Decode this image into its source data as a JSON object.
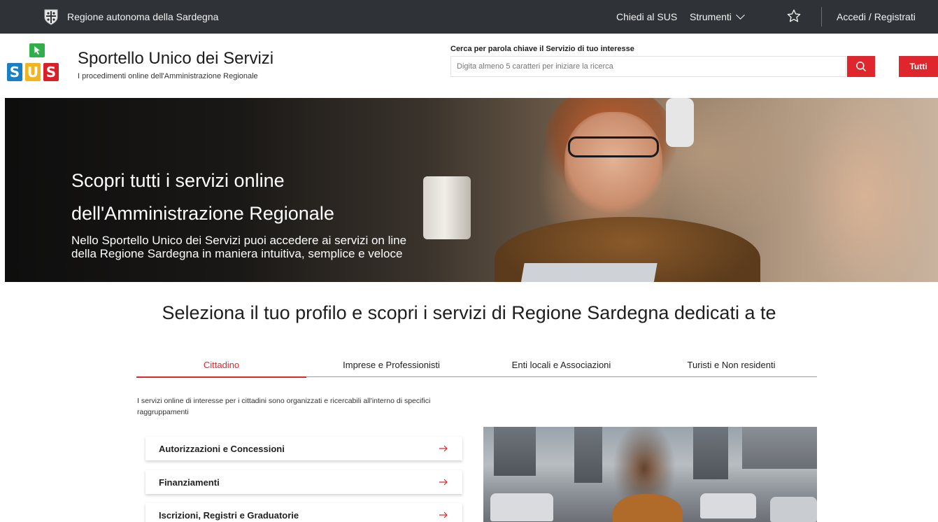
{
  "topbar": {
    "region": "Regione autonoma della Sardegna",
    "ask": "Chiedi al SUS",
    "tools": "Strumenti",
    "login": "Accedi / Registrati"
  },
  "header": {
    "logo_letters": [
      "S",
      "U",
      "S"
    ],
    "title": "Sportello Unico dei Servizi",
    "subtitle": "I procedimenti online dell'Amministrazione Regionale",
    "search_label": "Cerca per parola chiave il Servizio di tuo interesse",
    "search_placeholder": "Digita almeno 5 caratteri per iniziare la ricerca",
    "search_value": "",
    "all_label": "Tutti"
  },
  "hero": {
    "title_line1": "Scopri tutti i servizi online",
    "title_line2": "dell'Amministrazione Regionale",
    "text_line1": "Nello Sportello Unico dei Servizi puoi accedere ai servizi on line",
    "text_line2": "della Regione Sardegna in maniera intuitiva, semplice e veloce"
  },
  "profiles": {
    "title": "Seleziona il tuo profilo e scopri i servizi di Regione Sardegna dedicati a te",
    "tabs": [
      "Cittadino",
      "Imprese e Professionisti",
      "Enti locali e Associazioni",
      "Turisti e Non residenti"
    ],
    "active_tab": "Cittadino",
    "intro": "I servizi online di interesse per i cittadini sono organizzati e ricercabili all'interno di specifici raggruppamenti",
    "categories": [
      "Autorizzazioni e Concessioni",
      "Finanziamenti",
      "Iscrizioni, Registri e Graduatorie"
    ]
  },
  "icons": {
    "crest": "region-crest-icon",
    "tools": "chevron-down-icon",
    "favorites": "star-icon",
    "search": "search-icon",
    "category": "arrow-right-icon"
  },
  "colors": {
    "topbar": "#2f3237",
    "accent": "#e0262d",
    "logo_blue": "#1b7fc4",
    "logo_yellow": "#f2b522",
    "logo_red": "#d72027",
    "logo_green": "#2fae49"
  }
}
